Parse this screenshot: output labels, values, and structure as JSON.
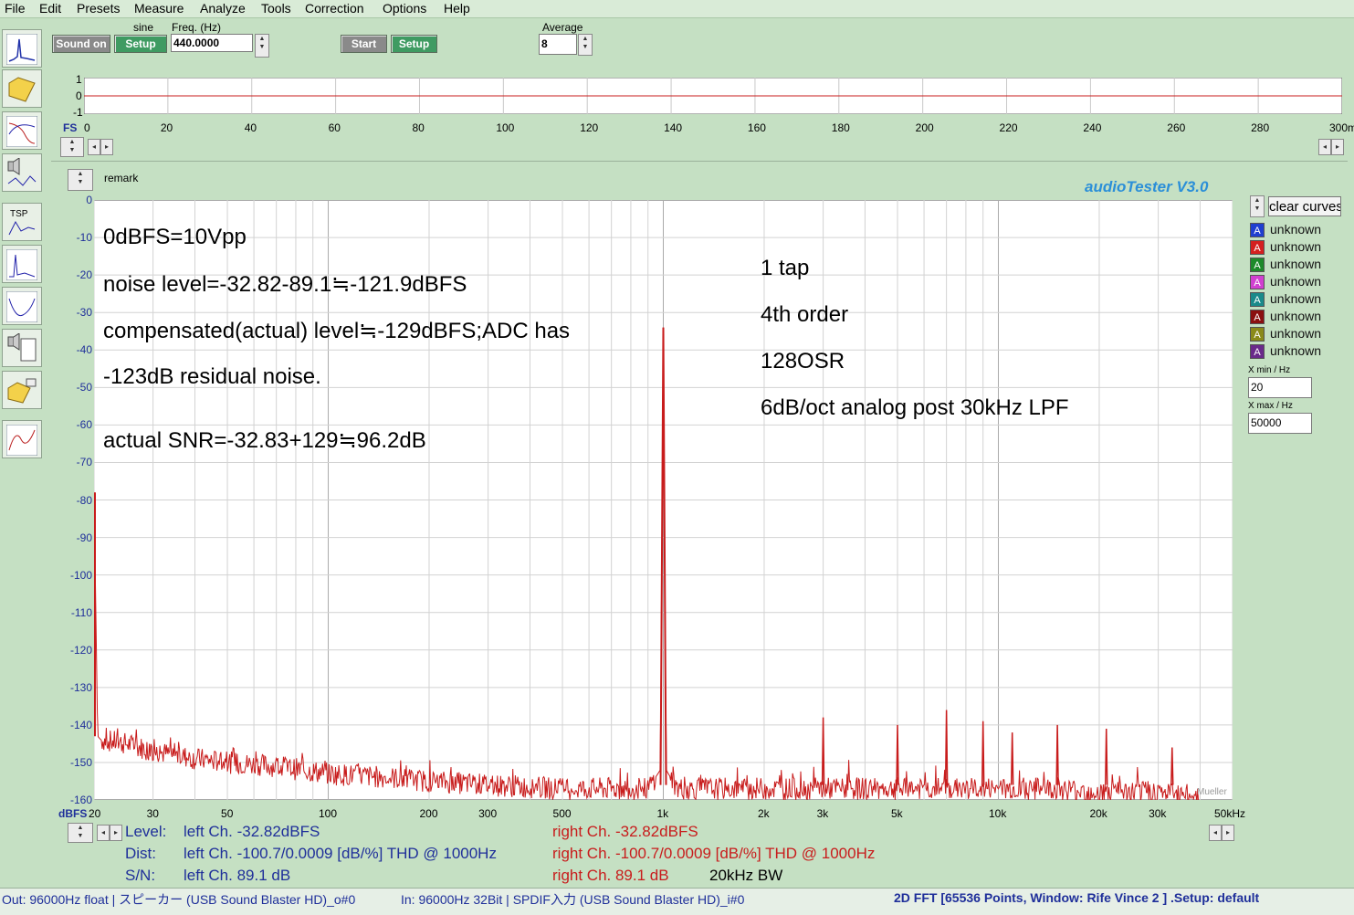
{
  "menu": [
    "File",
    "Edit",
    "Presets",
    "Measure",
    "Analyze",
    "Tools",
    "Correction",
    "Options",
    "Help"
  ],
  "toolbar": {
    "sound_on": "Sound on",
    "signal_label": "sine",
    "setup1": "Setup",
    "freq_label": "Freq. (Hz)",
    "freq_value": "440.0000",
    "start": "Start",
    "setup2": "Setup",
    "average_label": "Average",
    "average_value": "8"
  },
  "scope": {
    "fs_label": "FS",
    "y_ticks": [
      "1",
      "0",
      "-1"
    ],
    "x_ticks": [
      "0",
      "20",
      "40",
      "60",
      "80",
      "100",
      "120",
      "140",
      "160",
      "180",
      "200",
      "220",
      "240",
      "260",
      "280",
      "300m"
    ]
  },
  "main": {
    "remark_label": "remark",
    "app_title": "audioTester  V3.0",
    "y_unit": "dBFS",
    "watermark": "Mueller",
    "y_ticks": [
      "0",
      "-10",
      "-20",
      "-30",
      "-40",
      "-50",
      "-60",
      "-70",
      "-80",
      "-90",
      "-100",
      "-110",
      "-120",
      "-130",
      "-140",
      "-150",
      "-160"
    ],
    "x_ticks": [
      "20",
      "30",
      "50",
      "100",
      "200",
      "300",
      "500",
      "1k",
      "2k",
      "3k",
      "5k",
      "10k",
      "20k",
      "30k",
      "50kHz"
    ]
  },
  "annotations": {
    "left": [
      "0dBFS=10Vpp",
      "noise level=-32.82-89.1≒-121.9dBFS",
      "compensated(actual) level≒-129dBFS;ADC has",
      "-123dB residual noise.",
      " actual SNR=-32.83+129≒96.2dB"
    ],
    "right": [
      "1 tap",
      "4th order",
      "128OSR",
      "6dB/oct analog post 30kHz LPF"
    ]
  },
  "legend": {
    "clear_curves": "clear curves",
    "items": [
      {
        "letter": "A",
        "color": "#1f3fd0",
        "label": "unknown"
      },
      {
        "letter": "A",
        "color": "#d42020",
        "label": "unknown"
      },
      {
        "letter": "A",
        "color": "#1d8a2a",
        "label": "unknown"
      },
      {
        "letter": "A",
        "color": "#d040d0",
        "label": "unknown"
      },
      {
        "letter": "A",
        "color": "#1a8a8a",
        "label": "unknown"
      },
      {
        "letter": "A",
        "color": "#8a1010",
        "label": "unknown"
      },
      {
        "letter": "A",
        "color": "#8a8a1a",
        "label": "unknown"
      },
      {
        "letter": "A",
        "color": "#6a2a8a",
        "label": "unknown"
      }
    ],
    "xmin_label": "X min / Hz",
    "xmin_value": "20",
    "xmax_label": "X max / Hz",
    "xmax_value": "50000"
  },
  "measurements": {
    "level_label": "Level:",
    "level_left": "left Ch. -32.82dBFS",
    "level_right": "right Ch. -32.82dBFS",
    "dist_label": "Dist:",
    "dist_left": "left Ch. -100.7/0.0009 [dB/%] THD @ 1000Hz",
    "dist_right": "right Ch. -100.7/0.0009 [dB/%] THD @ 1000Hz",
    "sn_label": "S/N:",
    "sn_left": "left Ch. 89.1 dB",
    "sn_right": "right Ch. 89.1 dB",
    "bw": "20kHz BW"
  },
  "status": {
    "out": "Out: 96000Hz float  | スピーカー (USB Sound Blaster HD)_o#0",
    "in": "In: 96000Hz 32Bit  | SPDIF入力 (USB Sound Blaster HD)_i#0",
    "mode": "2D FFT [65536 Points, Window: Rife Vince 2 ]  .Setup:  default"
  },
  "colors": {
    "trace": "#c81c1c",
    "background": "#c5e0c3",
    "tick_blue": "#1f2f9a"
  },
  "chart_data": {
    "type": "line",
    "title": "",
    "xlabel": "",
    "ylabel": "dBFS",
    "xscale": "log",
    "xlim": [
      20,
      50000
    ],
    "ylim": [
      -160,
      0
    ],
    "grid": true,
    "series": [
      {
        "x": [
          20,
          20.5,
          21,
          25,
          30,
          40,
          50,
          70,
          100,
          150,
          200,
          300,
          500,
          700,
          900,
          980,
          1000,
          1020,
          1100,
          1500,
          2000,
          3000,
          5000,
          7000,
          10000,
          15000,
          20000,
          30000,
          40000
        ],
        "y": [
          -78,
          -143,
          -144,
          -145,
          -147,
          -149,
          -150,
          -151,
          -153,
          -154,
          -155,
          -156,
          -157,
          -157,
          -157,
          -152,
          -34,
          -152,
          -157,
          -157,
          -157,
          -157,
          -157,
          -157,
          -157,
          -157,
          -158,
          -158,
          -159
        ],
        "peaks": [
          {
            "x": 1000,
            "y": -34
          },
          {
            "x": 3000,
            "y": -138
          },
          {
            "x": 5000,
            "y": -140
          },
          {
            "x": 7000,
            "y": -136
          },
          {
            "x": 9000,
            "y": -139
          },
          {
            "x": 11000,
            "y": -142
          },
          {
            "x": 15000,
            "y": -140
          },
          {
            "x": 21000,
            "y": -141
          },
          {
            "x": 33000,
            "y": -146
          }
        ]
      }
    ]
  }
}
